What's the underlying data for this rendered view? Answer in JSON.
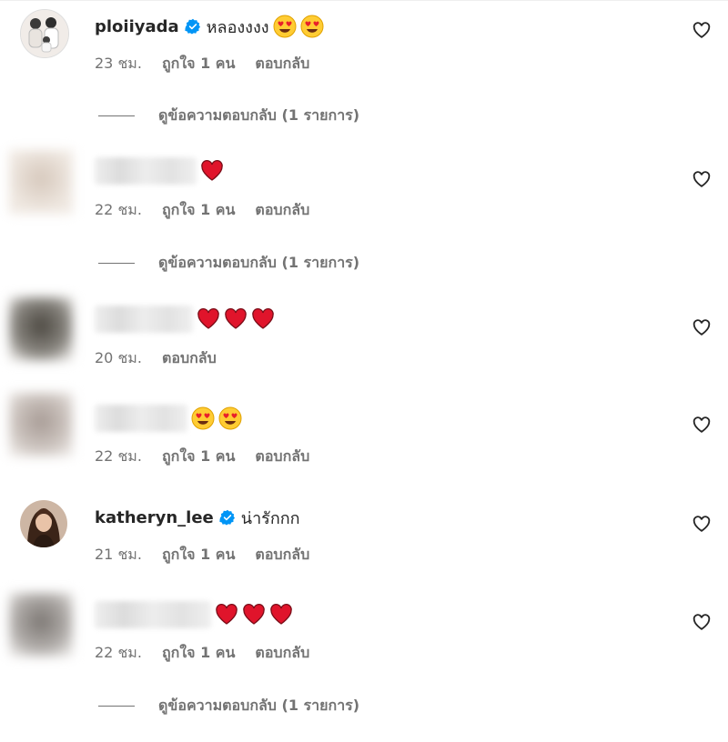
{
  "comments": [
    {
      "username": "ploiiyada",
      "verified": true,
      "text": "หลองงงง",
      "emojis": [
        "heart-eyes-emoji",
        "heart-eyes-emoji"
      ],
      "time": "23 ชม.",
      "likes": "ถูกใจ 1 คน",
      "reply": "ตอบกลับ",
      "view_replies": "ดูข้อความตอบกลับ (1 รายการ)"
    },
    {
      "username_hidden": true,
      "emojis": [
        "red-heart-emoji"
      ],
      "time": "22 ชม.",
      "likes": "ถูกใจ 1 คน",
      "reply": "ตอบกลับ",
      "view_replies": "ดูข้อความตอบกลับ (1 รายการ)"
    },
    {
      "username_hidden": true,
      "emojis": [
        "red-heart-emoji",
        "red-heart-emoji",
        "red-heart-emoji"
      ],
      "time": "20 ชม.",
      "reply": "ตอบกลับ"
    },
    {
      "username_hidden": true,
      "emojis": [
        "heart-eyes-emoji",
        "heart-eyes-emoji"
      ],
      "time": "22 ชม.",
      "likes": "ถูกใจ 1 คน",
      "reply": "ตอบกลับ"
    },
    {
      "username": "katheryn_lee",
      "verified": true,
      "text": "น่ารักกก",
      "time": "21 ชม.",
      "likes": "ถูกใจ 1 คน",
      "reply": "ตอบกลับ"
    },
    {
      "username_hidden": true,
      "emojis": [
        "red-heart-emoji",
        "red-heart-emoji",
        "red-heart-emoji"
      ],
      "time": "22 ชม.",
      "likes": "ถูกใจ 1 คน",
      "reply": "ตอบกลับ",
      "view_replies": "ดูข้อความตอบกลับ (1 รายการ)"
    }
  ],
  "colors": {
    "text": "#262626",
    "secondary": "#737373",
    "verified": "#0095f6",
    "heart": "#e0142b"
  },
  "icons": [
    "like-heart-outline-icon",
    "verified-badge-icon"
  ]
}
